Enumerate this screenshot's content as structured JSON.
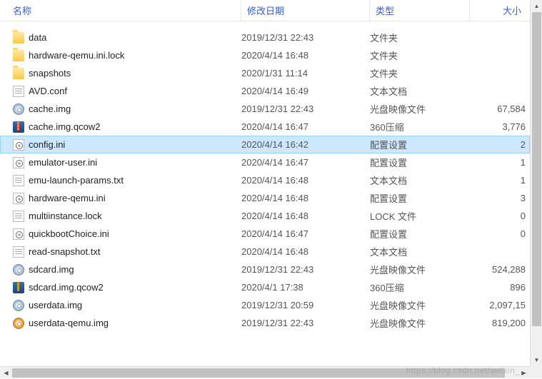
{
  "columns": {
    "name": "名称",
    "date": "修改日期",
    "type": "类型",
    "size": "大小"
  },
  "files": [
    {
      "icon": "folder",
      "name": "data",
      "date": "2019/12/31 22:43",
      "type": "文件夹",
      "size": ""
    },
    {
      "icon": "folder",
      "name": "hardware-qemu.ini.lock",
      "date": "2020/4/14 16:48",
      "type": "文件夹",
      "size": ""
    },
    {
      "icon": "folder",
      "name": "snapshots",
      "date": "2020/1/31 11:14",
      "type": "文件夹",
      "size": ""
    },
    {
      "icon": "txtdoc",
      "name": "AVD.conf",
      "date": "2020/4/14 16:49",
      "type": "文本文档",
      "size": ""
    },
    {
      "icon": "disc",
      "name": "cache.img",
      "date": "2019/12/31 22:43",
      "type": "光盘映像文件",
      "size": "67,584"
    },
    {
      "icon": "archive",
      "name": "cache.img.qcow2",
      "date": "2020/4/14 16:47",
      "type": "360压缩",
      "size": "3,776"
    },
    {
      "icon": "ini",
      "name": "config.ini",
      "date": "2020/4/14 16:42",
      "type": "配置设置",
      "size": "2",
      "selected": true
    },
    {
      "icon": "ini",
      "name": "emulator-user.ini",
      "date": "2020/4/14 16:47",
      "type": "配置设置",
      "size": "1"
    },
    {
      "icon": "txtdoc",
      "name": "emu-launch-params.txt",
      "date": "2020/4/14 16:48",
      "type": "文本文档",
      "size": "1"
    },
    {
      "icon": "ini",
      "name": "hardware-qemu.ini",
      "date": "2020/4/14 16:48",
      "type": "配置设置",
      "size": "3"
    },
    {
      "icon": "txtdoc",
      "name": "multiinstance.lock",
      "date": "2020/4/14 16:48",
      "type": "LOCK 文件",
      "size": "0"
    },
    {
      "icon": "ini",
      "name": "quickbootChoice.ini",
      "date": "2020/4/14 16:47",
      "type": "配置设置",
      "size": "0"
    },
    {
      "icon": "txtdoc",
      "name": "read-snapshot.txt",
      "date": "2020/4/14 16:48",
      "type": "文本文档",
      "size": ""
    },
    {
      "icon": "disc",
      "name": "sdcard.img",
      "date": "2019/12/31 22:43",
      "type": "光盘映像文件",
      "size": "524,288"
    },
    {
      "icon": "archive",
      "name": "sdcard.img.qcow2",
      "date": "2020/4/1 17:38",
      "type": "360压缩",
      "size": "896"
    },
    {
      "icon": "disc",
      "name": "userdata.img",
      "date": "2019/12/31 20:59",
      "type": "光盘映像文件",
      "size": "2,097,15"
    },
    {
      "icon": "disc-orange",
      "name": "userdata-qemu.img",
      "date": "2019/12/31 22:43",
      "type": "光盘映像文件",
      "size": "819,200"
    }
  ],
  "watermark": "https://blog.csdn.net/weixin_..."
}
